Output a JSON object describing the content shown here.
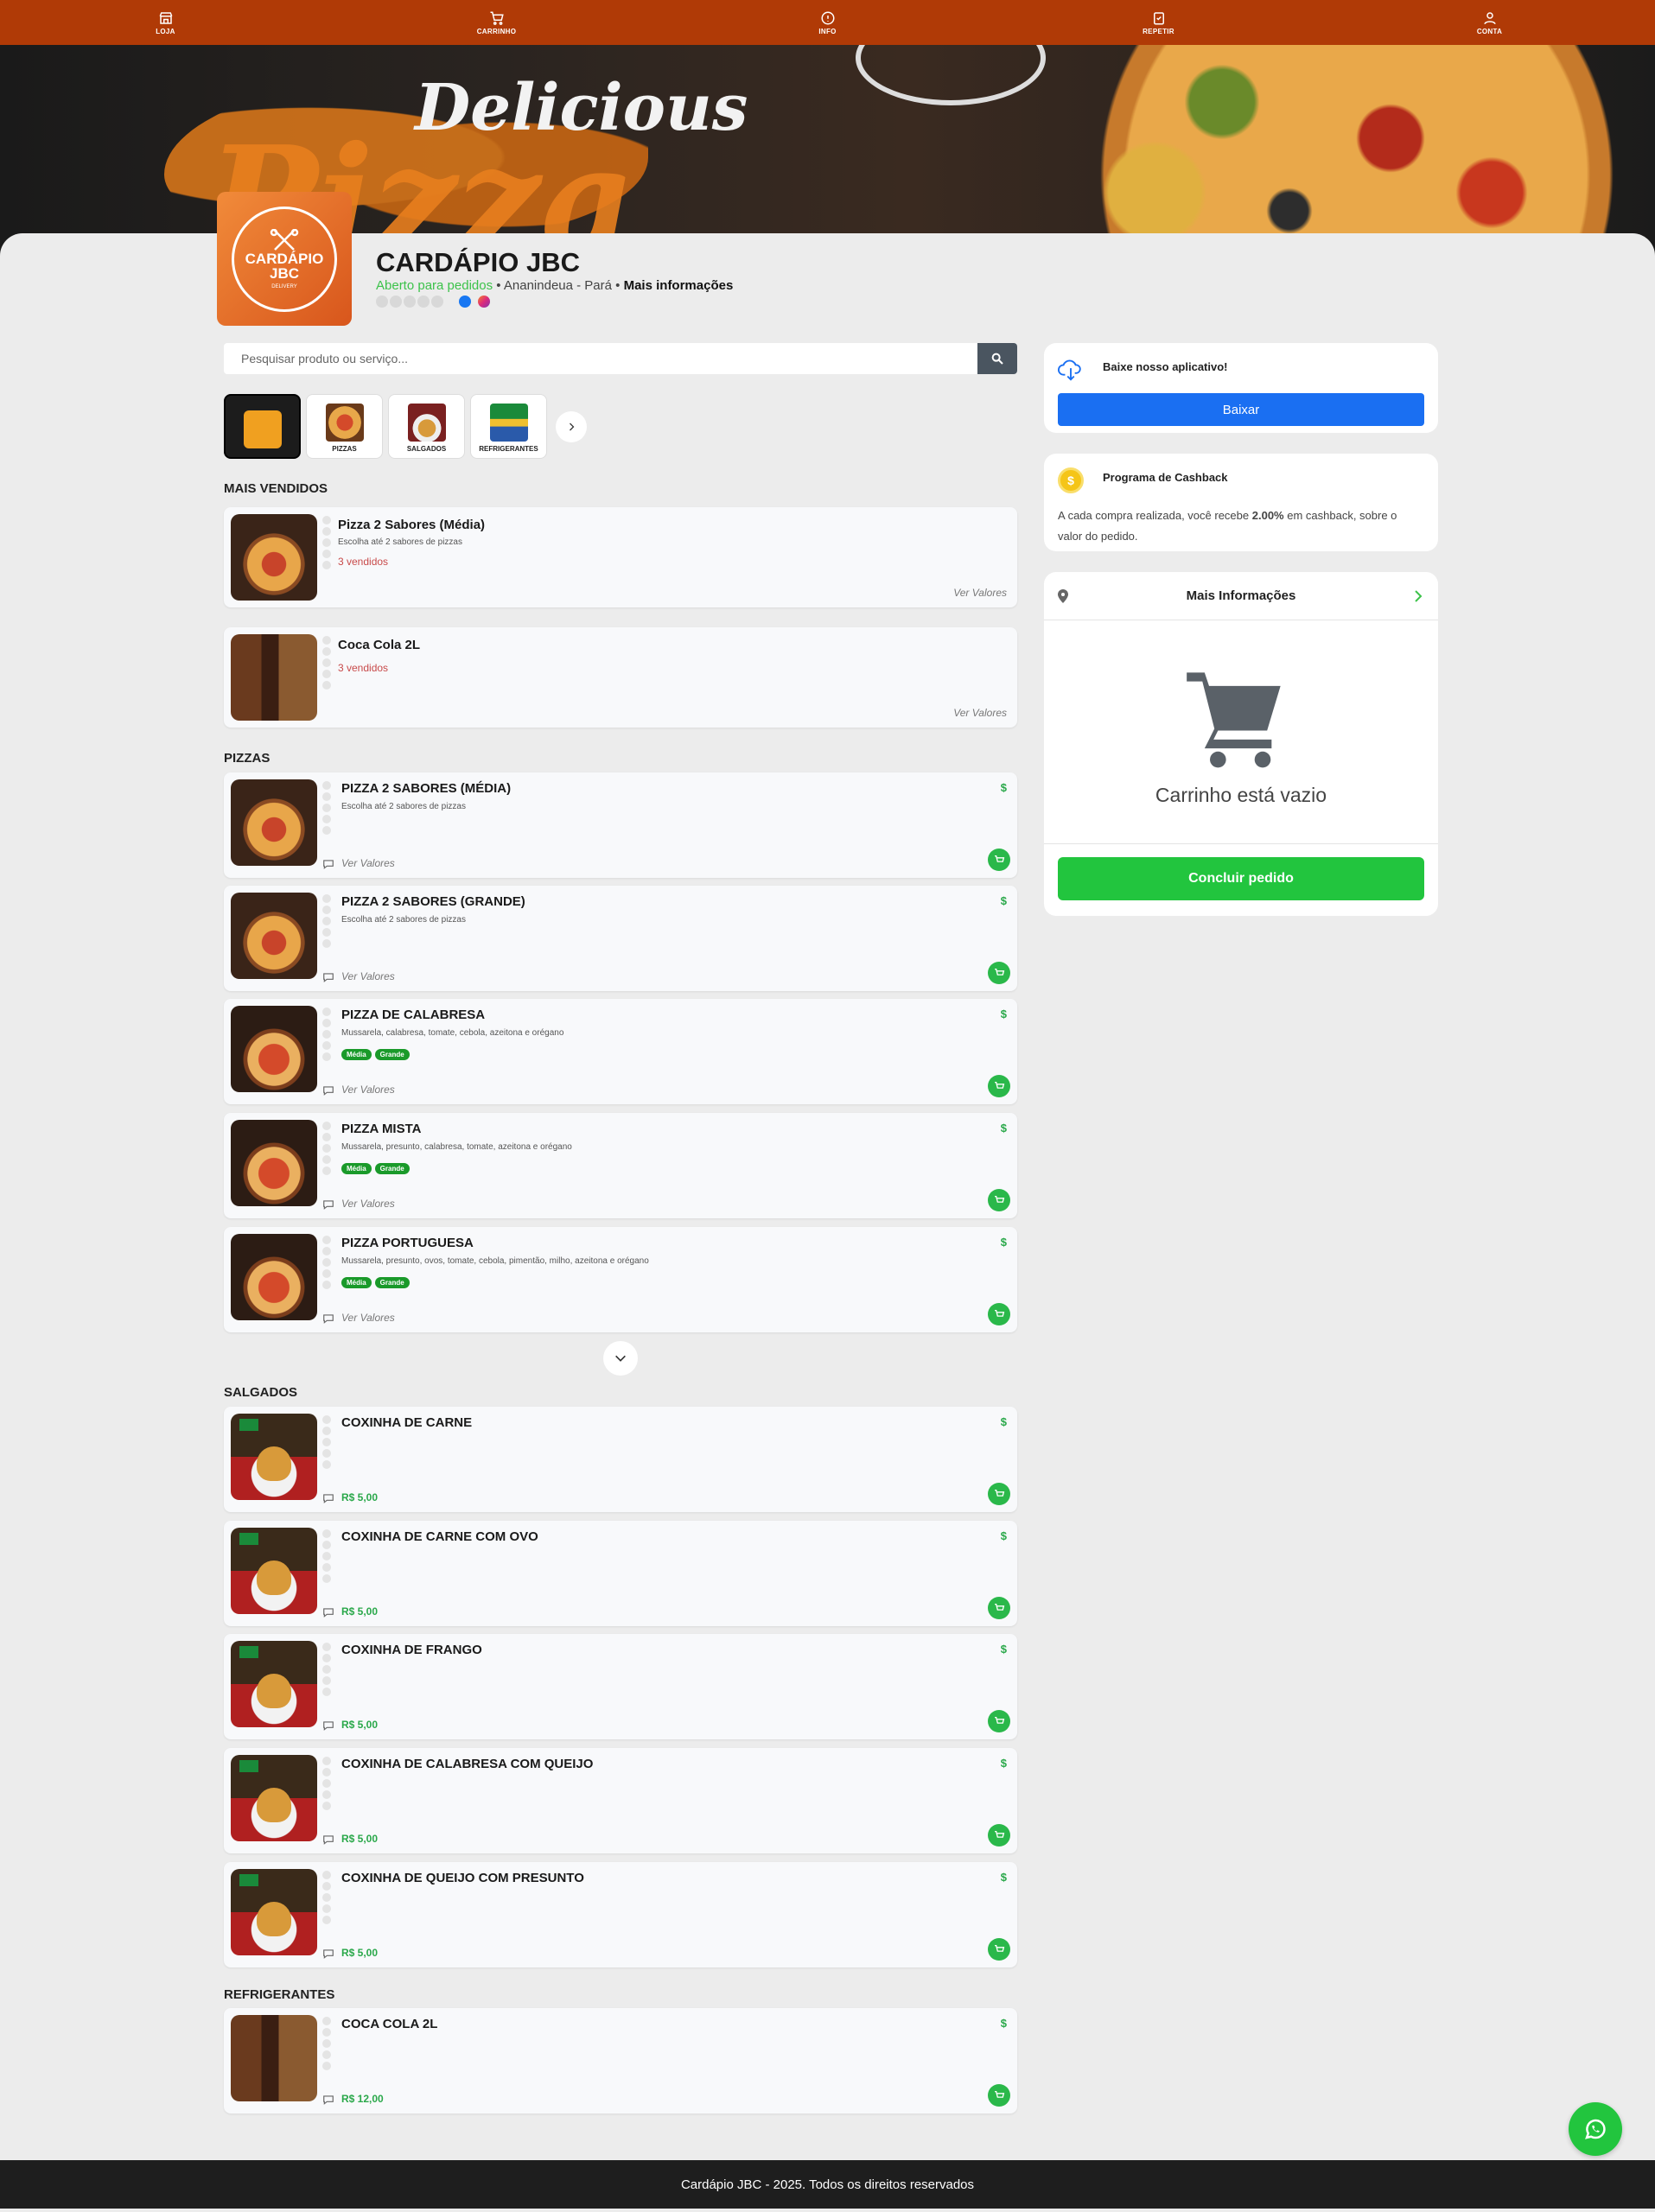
{
  "nav": {
    "items": [
      {
        "label": "LOJA",
        "icon": "store-icon"
      },
      {
        "label": "CARRINHO",
        "icon": "cart-icon"
      },
      {
        "label": "INFO",
        "icon": "info-icon"
      },
      {
        "label": "REPETIR",
        "icon": "repeat-icon"
      },
      {
        "label": "CONTA",
        "icon": "user-icon"
      }
    ]
  },
  "hero": {
    "script_text": "Delicious",
    "big_text": "Pizza"
  },
  "store": {
    "logo_text": "CARDÁPIO JBC",
    "logo_sub": "DELIVERY",
    "name": "CARDÁPIO JBC",
    "status": "Aberto para pedidos",
    "separator": "•",
    "location": "Ananindeua - Pará",
    "more_info": "Mais informações"
  },
  "search": {
    "placeholder": "Pesquisar produto ou serviço..."
  },
  "categories": [
    {
      "label": "",
      "icon": "menu-icon"
    },
    {
      "label": "PIZZAS"
    },
    {
      "label": "SALGADOS"
    },
    {
      "label": "REFRIGERANTES"
    }
  ],
  "sections": {
    "best": "MAIS VENDIDOS",
    "pizzas": "PIZZAS",
    "salgados": "SALGADOS",
    "refri": "REFRIGERANTES"
  },
  "best_sellers": [
    {
      "name": "Pizza 2 Sabores (Média)",
      "desc": "Escolha até 2 sabores de pizzas",
      "sold": "3 vendidos",
      "link": "Ver Valores"
    },
    {
      "name": "Coca Cola 2L",
      "desc": "",
      "sold": "3 vendidos",
      "link": "Ver Valores"
    }
  ],
  "pizzas": [
    {
      "name": "PIZZA 2 SABORES (MÉDIA)",
      "desc": "Escolha até 2 sabores de pizzas",
      "link": "Ver Valores",
      "currency": "$"
    },
    {
      "name": "PIZZA 2 SABORES (GRANDE)",
      "desc": "Escolha até 2 sabores de pizzas",
      "link": "Ver Valores",
      "currency": "$"
    },
    {
      "name": "PIZZA DE CALABRESA",
      "desc": "Mussarela, calabresa, tomate, cebola, azeitona e orégano",
      "tags": [
        "Média",
        "Grande"
      ],
      "link": "Ver Valores",
      "currency": "$"
    },
    {
      "name": "PIZZA MISTA",
      "desc": "Mussarela, presunto, calabresa, tomate, azeitona e orégano",
      "tags": [
        "Média",
        "Grande"
      ],
      "link": "Ver Valores",
      "currency": "$"
    },
    {
      "name": "PIZZA PORTUGUESA",
      "desc": "Mussarela, presunto, ovos, tomate, cebola, pimentão, milho, azeitona e orégano",
      "tags": [
        "Média",
        "Grande"
      ],
      "link": "Ver Valores",
      "currency": "$"
    }
  ],
  "salgados": [
    {
      "name": "COXINHA DE CARNE",
      "price": "R$ 5,00",
      "currency": "$"
    },
    {
      "name": "COXINHA DE CARNE COM OVO",
      "price": "R$ 5,00",
      "currency": "$"
    },
    {
      "name": "COXINHA DE FRANGO",
      "price": "R$ 5,00",
      "currency": "$"
    },
    {
      "name": "COXINHA DE CALABRESA COM QUEIJO",
      "price": "R$ 5,00",
      "currency": "$"
    },
    {
      "name": "COXINHA DE QUEIJO COM PRESUNTO",
      "price": "R$ 5,00",
      "currency": "$"
    }
  ],
  "refrigerantes": [
    {
      "name": "COCA COLA 2L",
      "price": "R$ 12,00",
      "currency": "$"
    }
  ],
  "app_card": {
    "title": "Baixe nosso aplicativo!",
    "button": "Baixar"
  },
  "cashback": {
    "title": "Programa de Cashback",
    "text_before": "A cada compra realizada, você recebe ",
    "percent": "2.00%",
    "text_after": " em cashback, sobre o valor do pedido."
  },
  "cart": {
    "info_label": "Mais Informações",
    "empty": "Carrinho está vazio",
    "checkout": "Concluir pedido"
  },
  "footer": {
    "text": "Cardápio JBC - 2025. Todos os direitos reservados"
  },
  "colors": {
    "nav": "#b03a06",
    "green": "#22c53e",
    "blue": "#1a6ff2"
  }
}
